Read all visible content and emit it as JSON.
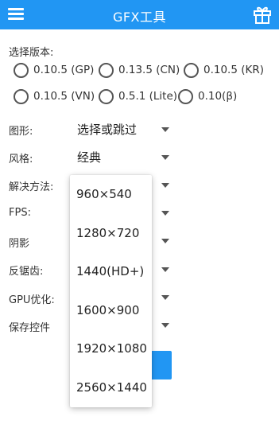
{
  "colors": {
    "accent": "#2196F3"
  },
  "appbar": {
    "title": "GFX工具",
    "menu_icon": "hamburger-menu-icon",
    "gift_icon": "gift-icon"
  },
  "version": {
    "label": "选择版本:",
    "options": [
      "0.10.5 (GP)",
      "0.13.5 (CN)",
      "0.10.5 (KR)",
      "0.10.5 (VN)",
      "0.5.1 (Lite)",
      "0.10(β)"
    ]
  },
  "settings": {
    "graphics_label": "图形:",
    "graphics_value": "选择或跳过",
    "style_label": "风格:",
    "style_value": "经典",
    "resolution_label": "解决方法:",
    "fps_label": "FPS:",
    "shadow_label": "阴影",
    "antialias_label": "反锯齿:",
    "gpu_label": "GPU优化:",
    "save_label": "保存控件"
  },
  "resolution_dropdown": {
    "options": [
      "960×540",
      "1280×720",
      "1440(HD+)",
      "1600×900",
      "1920×1080",
      "2560×1440"
    ]
  }
}
